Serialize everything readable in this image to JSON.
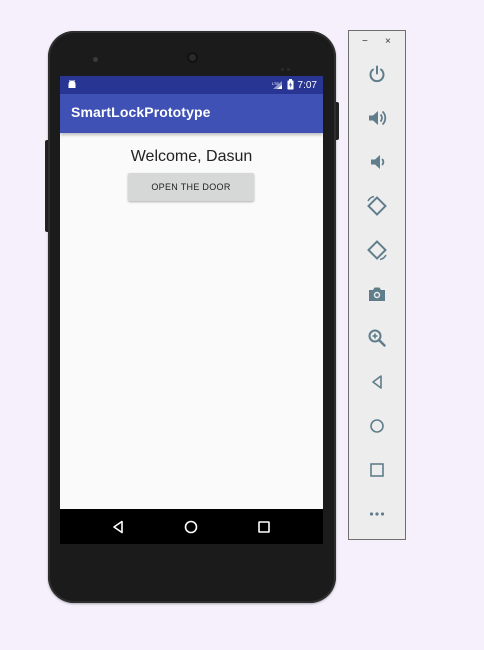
{
  "phone": {
    "status_bar": {
      "time": "7:07"
    },
    "app_bar": {
      "title": "SmartLockPrototype"
    },
    "content": {
      "welcome_text": "Welcome, Dasun",
      "open_button_label": "OPEN THE DOOR"
    },
    "nav_bar": {
      "icons": [
        "back-icon",
        "home-icon",
        "recents-icon"
      ]
    }
  },
  "emulator_toolbar": {
    "window_controls": {
      "minimize": "−",
      "close": "×"
    },
    "buttons": [
      "power-icon",
      "volume-up-icon",
      "volume-down-icon",
      "rotate-left-icon",
      "rotate-right-icon",
      "camera-icon",
      "zoom-icon",
      "back-icon",
      "home-icon",
      "overview-icon",
      "more-icon"
    ]
  },
  "colors": {
    "status_bar": "#283593",
    "app_bar": "#3f51b5",
    "background": "#f5f0fb",
    "toolbar_icon": "#607d8b"
  }
}
